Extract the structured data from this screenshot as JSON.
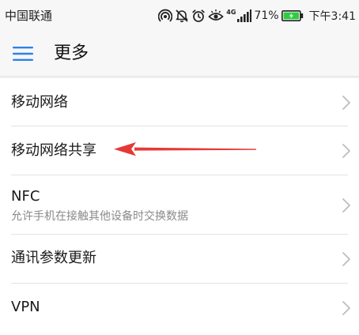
{
  "status_bar": {
    "carrier": "中国联通",
    "network_label": "4G",
    "battery_percent": "71%",
    "time": "下午3:41",
    "icons": [
      "hotspot-icon",
      "mute-icon",
      "alarm-icon",
      "eye-comfort-icon",
      "signal-icon",
      "battery-charging-icon"
    ]
  },
  "toolbar": {
    "menu_icon": "hamburger-menu-icon",
    "title": "更多"
  },
  "list": {
    "items": [
      {
        "title": "移动网络"
      },
      {
        "title": "移动网络共享"
      },
      {
        "title": "NFC",
        "subtitle": "允许手机在接触其他设备时交换数据"
      },
      {
        "title": "通讯参数更新"
      },
      {
        "title": "VPN"
      }
    ],
    "chevron_icon": "chevron-right-icon"
  },
  "colors": {
    "accent": "#2f80ed",
    "annotation": "#e53935",
    "battery": "#2ecc40",
    "chevron": "#bdbdbd",
    "divider": "#e3e3e3",
    "subtitle": "#8a8a8a"
  }
}
